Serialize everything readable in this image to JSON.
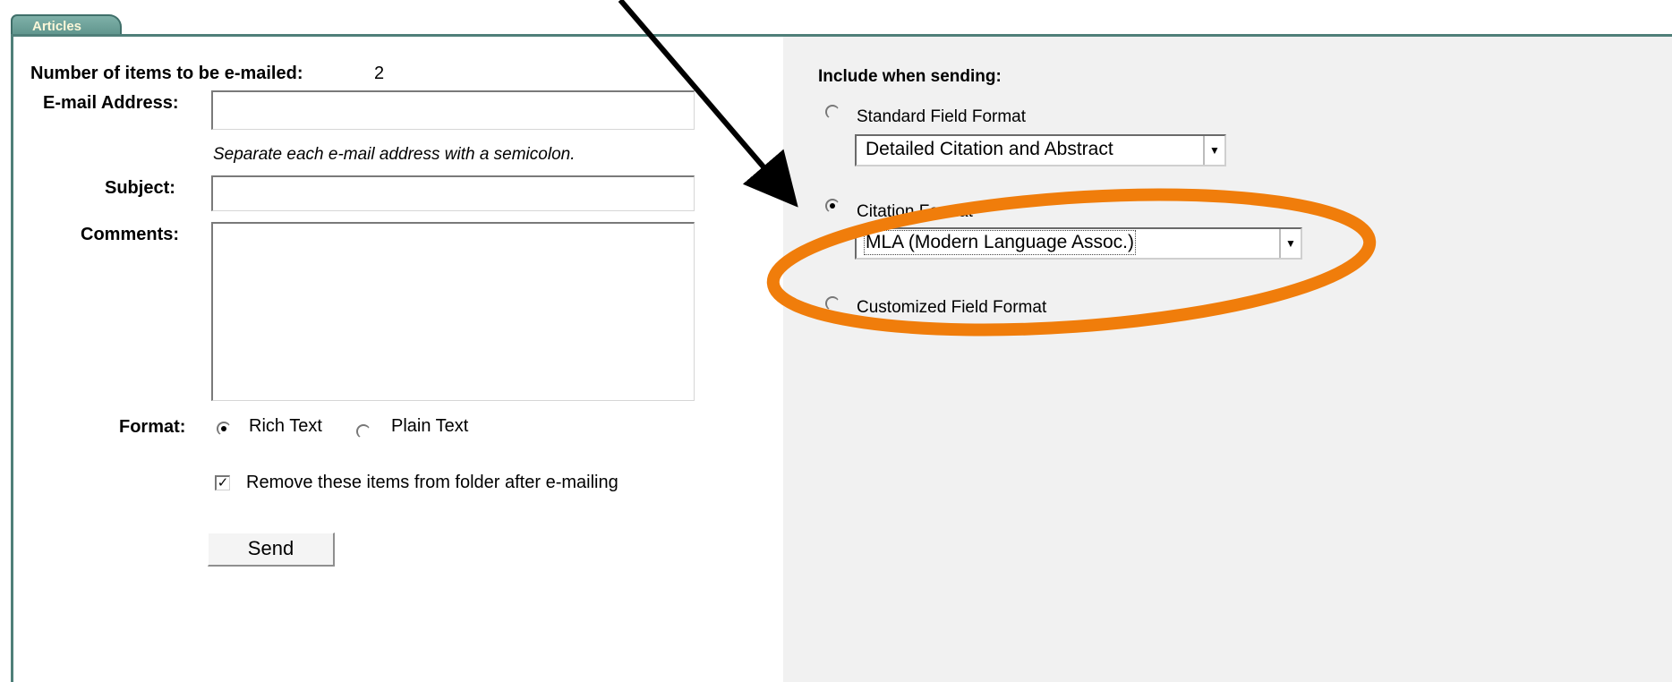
{
  "tab": {
    "label": "Articles"
  },
  "email_form": {
    "items_count_label": "Number of items to be e-mailed:",
    "items_count_value": "2",
    "email_label": "E-mail Address:",
    "email_value": "",
    "email_hint": "Separate each e-mail address with a semicolon.",
    "subject_label": "Subject:",
    "subject_value": "",
    "comments_label": "Comments:",
    "comments_value": "",
    "format_label": "Format:",
    "format_options": [
      {
        "label": "Rich Text",
        "selected": true
      },
      {
        "label": "Plain Text",
        "selected": false
      }
    ],
    "remove_items_label": "Remove these items from folder after e-mailing",
    "remove_items_checked": true,
    "send_label": "Send"
  },
  "include": {
    "heading": "Include when sending:",
    "options": [
      {
        "label": "Standard Field Format",
        "selected": false,
        "select_value": "Detailed Citation and Abstract"
      },
      {
        "label": "Citation Format",
        "selected": true,
        "select_value": "MLA (Modern Language Assoc.)"
      },
      {
        "label": "Customized Field Format",
        "selected": false
      }
    ]
  },
  "annotation": {
    "ellipse_color": "#f07d0b",
    "arrow_color": "#000000"
  }
}
